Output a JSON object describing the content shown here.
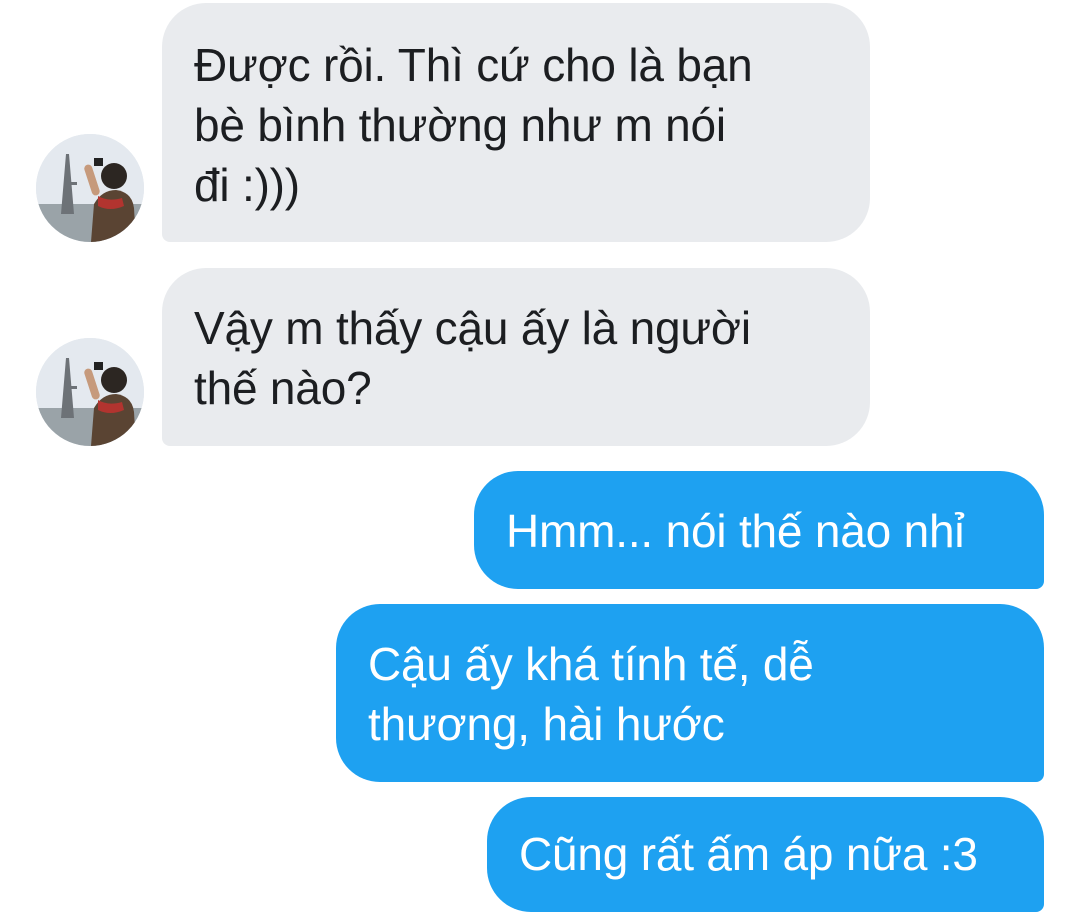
{
  "conversation": {
    "messages": [
      {
        "sender": "contact",
        "text": "Được rồi. Thì cứ cho là bạn\nbè bình thường như m nói\nđi :)))"
      },
      {
        "sender": "contact",
        "text": "Vậy m thấy cậu ấy là người\nthế nào?"
      },
      {
        "sender": "me",
        "text": "Hmm... nói thế nào nhỉ"
      },
      {
        "sender": "me",
        "text": "Cậu ấy khá tính tế, dễ\nthương, hài hước"
      },
      {
        "sender": "me",
        "text": "Cũng rất ấm áp nữa :3"
      }
    ],
    "avatar_icon": "contact-avatar-icon"
  },
  "colors": {
    "incoming_bubble": "#e9ebee",
    "outgoing_bubble": "#1ea1f1",
    "incoming_text": "#1c1e21",
    "outgoing_text": "#ffffff"
  }
}
